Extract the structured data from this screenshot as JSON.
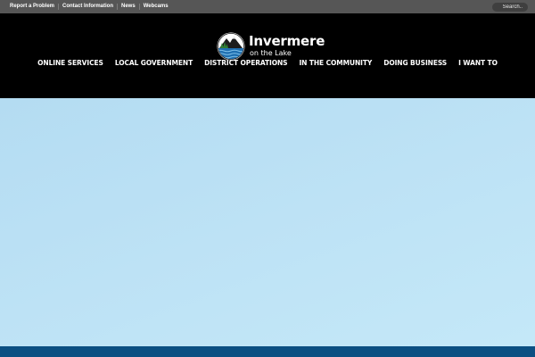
{
  "utility": {
    "links": [
      "Report a Problem",
      "Contact Information",
      "News",
      "Webcams"
    ],
    "search_placeholder": "Search.."
  },
  "brand": {
    "name": "Invermere",
    "tagline": "on the Lake",
    "emblem_icon": "lake-mountain-emblem-icon",
    "colors": {
      "lake_blue": "#1f6fb0",
      "forest_green": "#3c8a3c"
    }
  },
  "nav": {
    "items": [
      "ONLINE SERVICES",
      "LOCAL GOVERNMENT",
      "DISTRICT OPERATIONS",
      "IN THE COMMUNITY",
      "DOING BUSINESS",
      "I WANT TO"
    ]
  },
  "colors": {
    "utility_bar": "#565656",
    "header": "#000000",
    "hero": "#bde2f5",
    "footer_band": "#0b4f82"
  }
}
